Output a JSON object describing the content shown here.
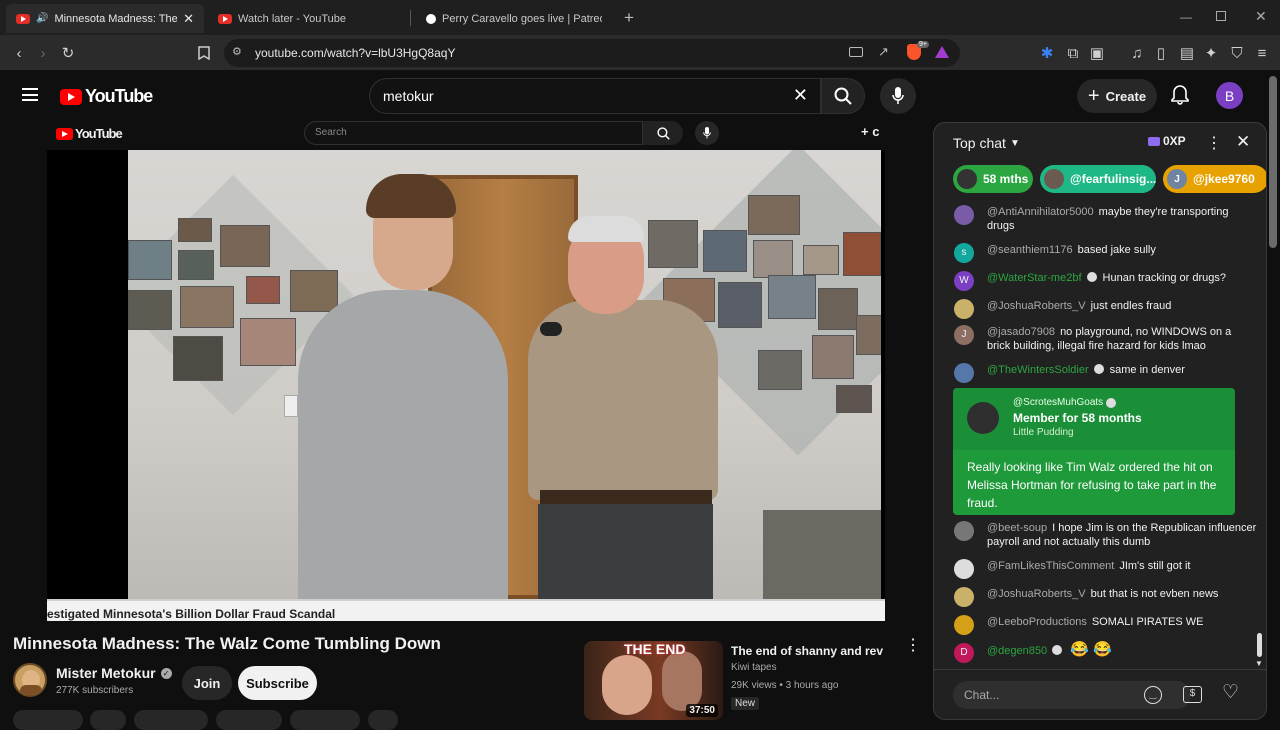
{
  "tabs": [
    {
      "label": "Minnesota Madness: The Wal",
      "active": true
    },
    {
      "label": "Watch later - YouTube",
      "active": false
    },
    {
      "label": "Perry Caravello goes live | Patreo",
      "active": false
    }
  ],
  "new_tab": "+",
  "url": "youtube.com/watch?v=lbU3HgQ8aqY",
  "extension_badge": "9+",
  "yt": {
    "logo_text": "YouTube",
    "search_value": "metokur",
    "create_label": "Create",
    "avatar_letter": "B"
  },
  "embedded": {
    "logo_text": "YouTube",
    "search_placeholder": "Search",
    "create_partial": "+ c",
    "caption": "estigated Minnesota's Billion Dollar Fraud Scandal"
  },
  "video": {
    "title": "Minnesota Madness: The Walz Come Tumbling Down",
    "channel": "Mister Metokur",
    "subscribers": "277K subscribers",
    "join_label": "Join",
    "subscribe_label": "Subscribe"
  },
  "recommended": {
    "thumb_text": "THE END",
    "duration": "37:50",
    "title": "The end of shanny and rev",
    "channel": "Kiwi tapes",
    "meta": "29K views • 3 hours ago",
    "badge": "New"
  },
  "chat": {
    "header": "Top chat",
    "xp": "0XP",
    "pills": [
      {
        "label": "58 mths",
        "color": "#2ba640"
      },
      {
        "label": "@fearfulinsig...",
        "color": "#1eb886"
      },
      {
        "label": "@jkee9760",
        "color": "#e8a200"
      }
    ],
    "messages": [
      {
        "author": "@AntiAnnihilator5000",
        "text": "maybe they're transporting drugs",
        "avatar_color": "#7a5ba8",
        "member": false,
        "emoji": ""
      },
      {
        "author": "@seanthiem1176",
        "text": "based jake sully",
        "avatar_color": "#13a89e",
        "avatar_letter": "s",
        "member": false,
        "emoji": ""
      },
      {
        "author": "@WaterStar-me2bf",
        "text": "Hunan tracking or drugs?",
        "avatar_color": "#7b3fc4",
        "avatar_letter": "W",
        "member": true,
        "emoji": ""
      },
      {
        "author": "@JoshuaRoberts_V",
        "text": "just endles fraud",
        "avatar_color": "#c9b169",
        "member": false,
        "emoji": ""
      },
      {
        "author": "@jasado7908",
        "text": "no playground, no WINDOWS on a brick building, illegal fire hazard for kids lmao",
        "avatar_color": "#8d6e63",
        "avatar_letter": "J",
        "member": false,
        "emoji": ""
      },
      {
        "author": "@TheWintersSoldier",
        "text": "same in denver",
        "avatar_color": "#5577aa",
        "member": true,
        "emoji": ""
      },
      {
        "author": "@beet-soup",
        "text": "I hope Jim is on the Republican influencer payroll and not actually this dumb",
        "avatar_color": "#777",
        "member": false,
        "emoji": ""
      },
      {
        "author": "@FamLikesThisComment",
        "text": "JIm's still got it",
        "avatar_color": "#ddd",
        "member": false,
        "emoji": ""
      },
      {
        "author": "@JoshuaRoberts_V",
        "text": "but that is not evben news",
        "avatar_color": "#c9b169",
        "member": false,
        "emoji": ""
      },
      {
        "author": "@LeeboProductions",
        "text": "SOMALI PIRATES WE",
        "avatar_color": "#d4a017",
        "member": false,
        "emoji": ""
      },
      {
        "author": "@degen850",
        "text": "",
        "avatar_color": "#c2185b",
        "avatar_letter": "D",
        "member": true,
        "emoji": "😂 😂"
      }
    ],
    "highlight": {
      "author": "@ScrotesMuhGoats",
      "subtitle": "Member for 58 months",
      "level": "Little Pudding",
      "text": "Really looking like Tim Walz ordered the hit on Melissa Hortman for refusing to take part in the fraud.",
      "color": "#2ba640"
    },
    "input_placeholder": "Chat..."
  }
}
